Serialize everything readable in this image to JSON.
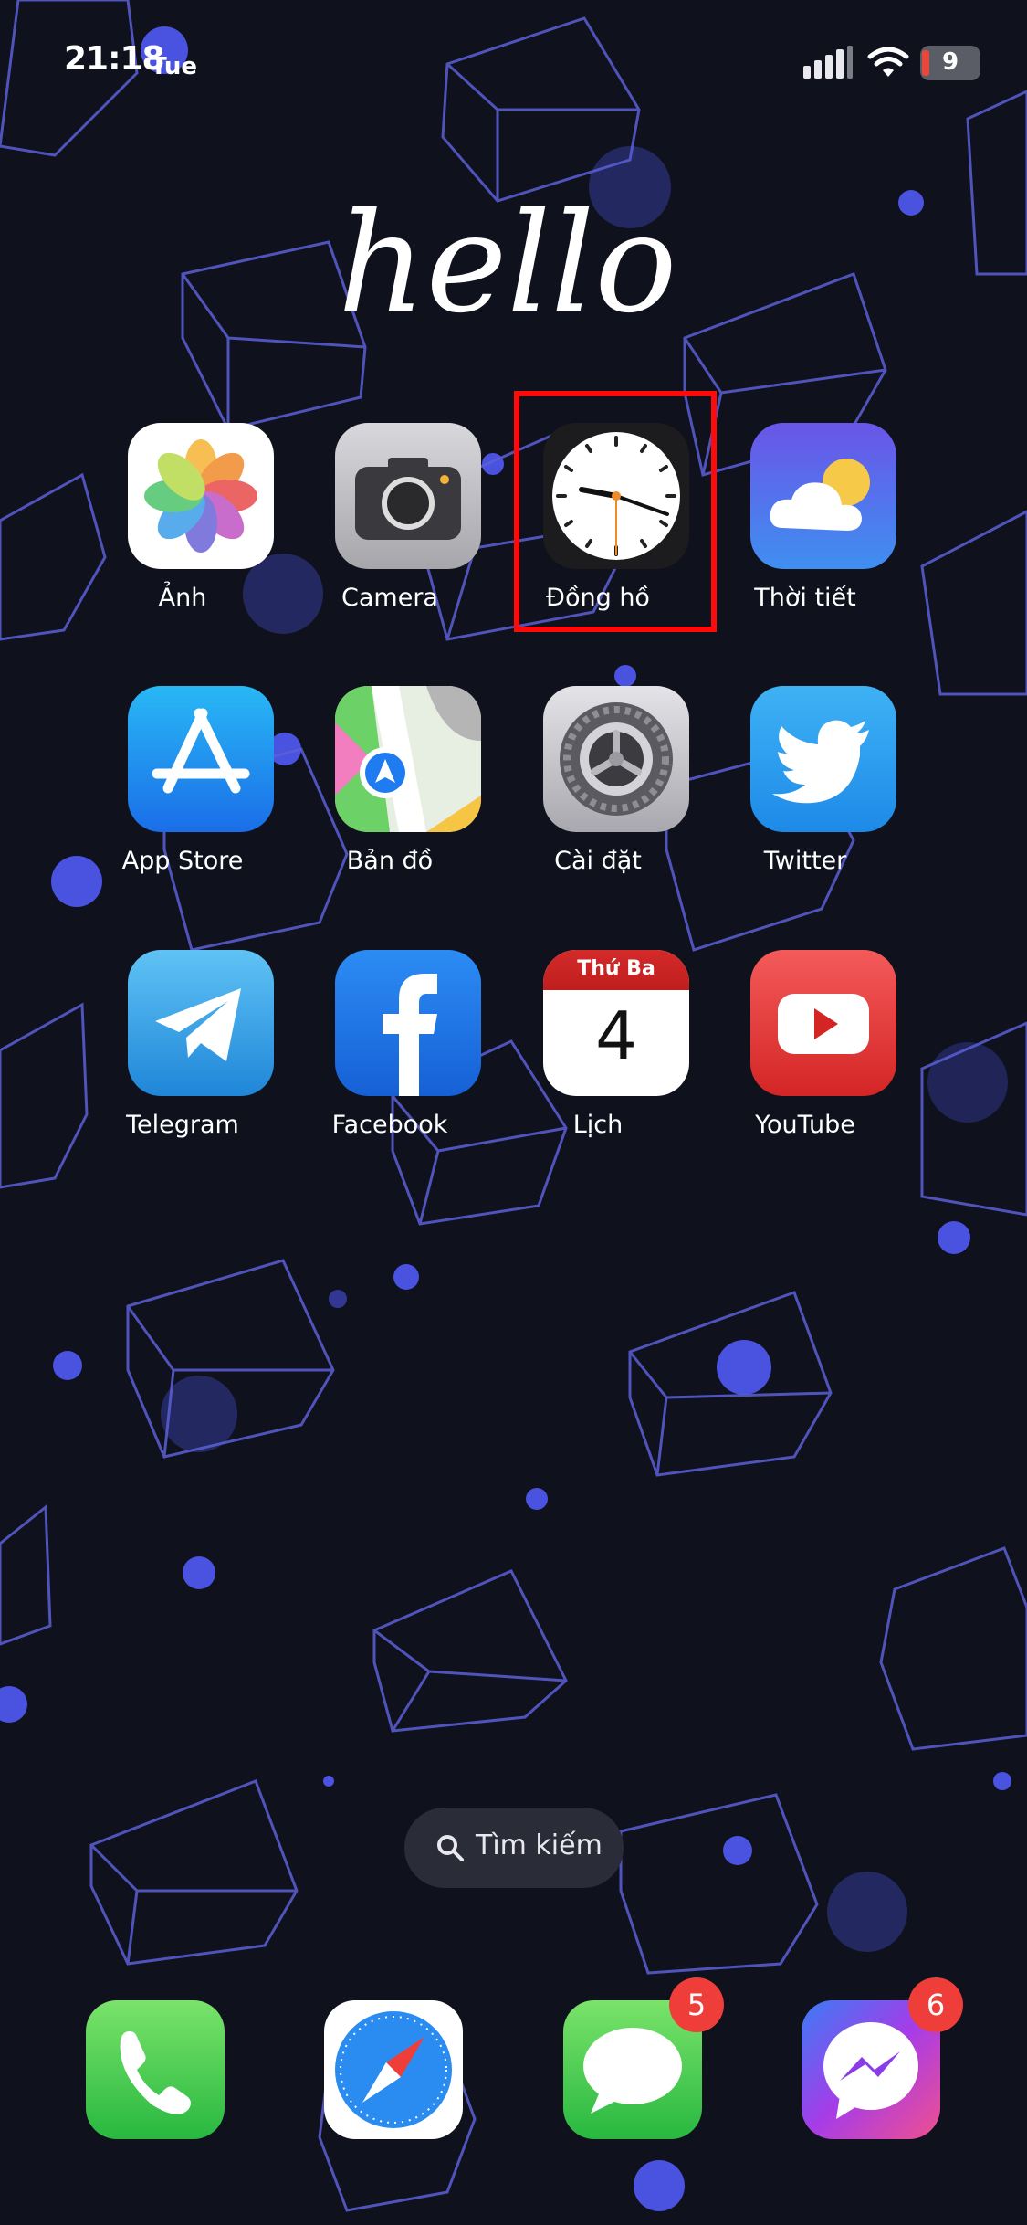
{
  "status_bar": {
    "time": "21:18",
    "day": "Tue",
    "battery": "9"
  },
  "wallpaper_text": "hello",
  "apps": [
    {
      "label": "Ảnh"
    },
    {
      "label": "Camera"
    },
    {
      "label": "Đồng hồ"
    },
    {
      "label": "Thời tiết"
    },
    {
      "label": "App Store"
    },
    {
      "label": "Bản đồ"
    },
    {
      "label": "Cài đặt"
    },
    {
      "label": "Twitter"
    },
    {
      "label": "Telegram"
    },
    {
      "label": "Facebook"
    },
    {
      "label": "Lịch"
    },
    {
      "label": "YouTube"
    }
  ],
  "calendar": {
    "weekday": "Thứ Ba",
    "date": "4"
  },
  "search": {
    "label": "Tìm kiếm"
  },
  "dock": {
    "messages_badge": "5",
    "messenger_badge": "6"
  },
  "colors": {
    "background": "#0f111c",
    "highlight": "#ff0a0a",
    "badge": "#ef3e3a"
  }
}
